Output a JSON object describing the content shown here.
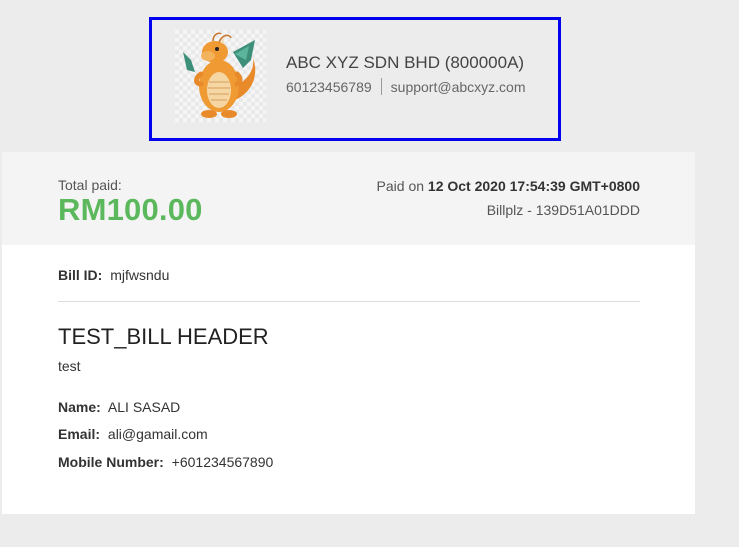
{
  "merchant": {
    "logo_icon": "dragon-mascot-icon",
    "name": "ABC XYZ SDN BHD (800000A)",
    "phone": "60123456789",
    "email": "support@abcxyz.com"
  },
  "summary": {
    "total_label": "Total paid:",
    "total_amount": "RM100.00",
    "paid_on_prefix": "Paid on",
    "paid_on_datetime": "12 Oct 2020 17:54:39 GMT+0800",
    "gateway_ref": "Billplz - 139D51A01DDD",
    "accent_color": "#5cb85c"
  },
  "bill": {
    "id_label": "Bill ID:",
    "id_value": "mjfwsndu",
    "title": "TEST_BILL HEADER",
    "description": "test"
  },
  "customer": {
    "name_label": "Name:",
    "name_value": "ALI SASAD",
    "email_label": "Email:",
    "email_value": "ali@gamail.com",
    "mobile_label": "Mobile Number:",
    "mobile_value": "+601234567890"
  },
  "colors": {
    "highlight_border": "#0000ee",
    "page_background": "#ececec"
  }
}
